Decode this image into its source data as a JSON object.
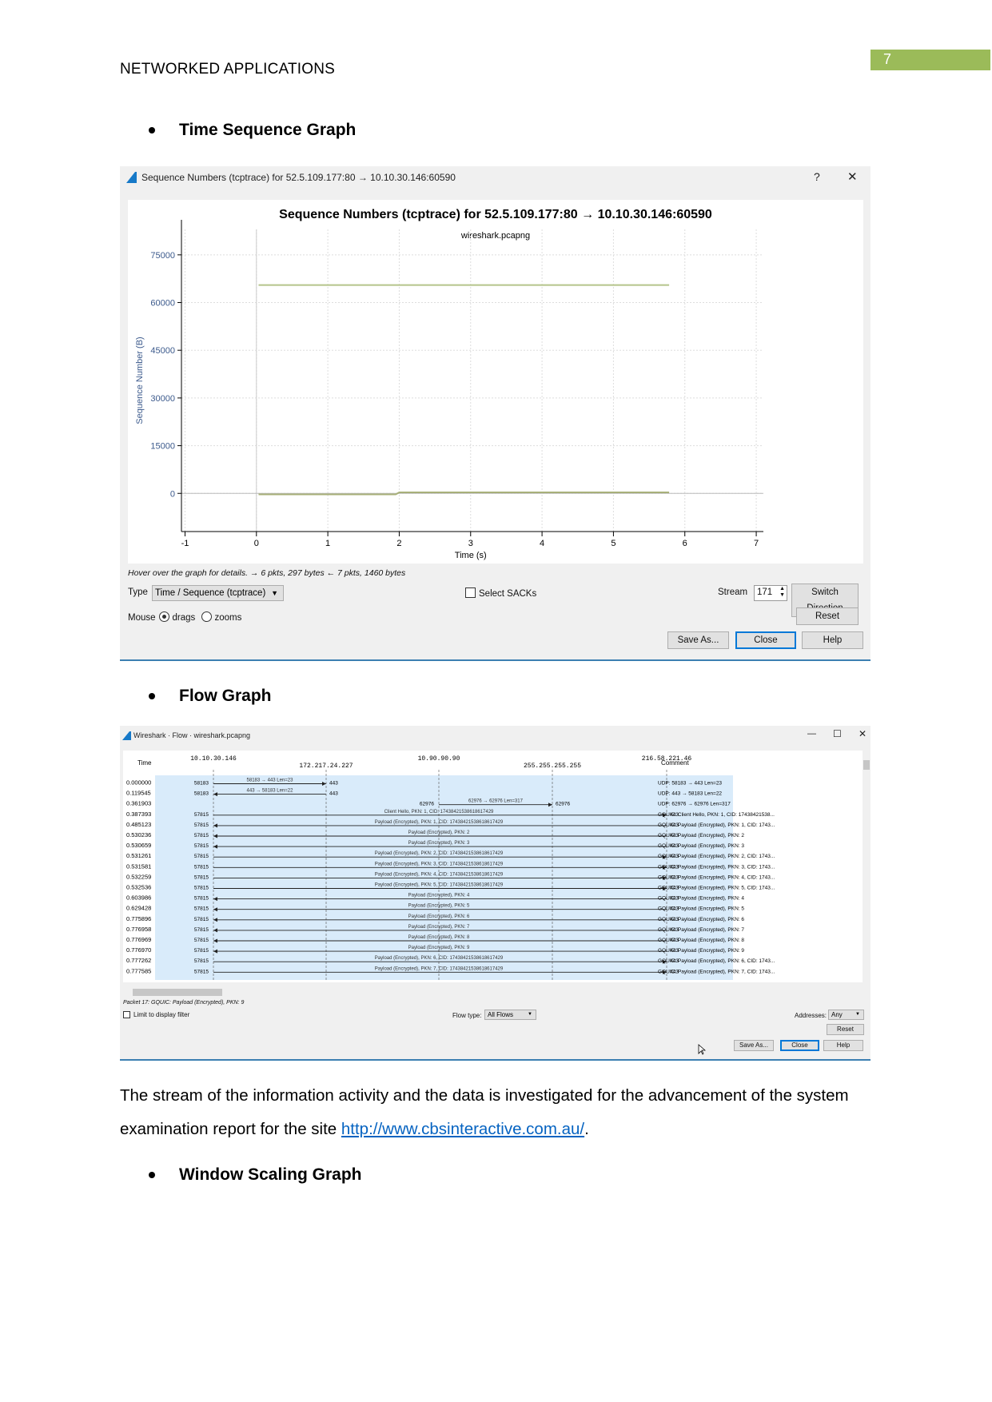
{
  "header": {
    "title": "NETWORKED APPLICATIONS",
    "page_number": "7",
    "accent": "#9bbb59"
  },
  "sections": [
    {
      "heading": "Time Sequence Graph"
    },
    {
      "heading": "Flow Graph"
    },
    {
      "heading": "Window Scaling Graph"
    }
  ],
  "paragraph": {
    "text_before": "The stream of the information activity and the data is investigated for the advancement of the system examination report for the site ",
    "link": "http://www.cbsinteractive.com.au/",
    "text_after": "."
  },
  "seq_window": {
    "title": "Sequence Numbers (tcptrace) for 52.5.109.177:80 → 10.10.30.146:60590",
    "help": "?",
    "close": "✕",
    "hover_text": "Hover over the graph for details. → 6 pkts, 297 bytes ← 7 pkts, 1460 bytes",
    "type_label": "Type",
    "type_value": "Time / Sequence (tcptrace)",
    "select_sacks": "Select SACKs",
    "stream_label": "Stream",
    "stream_value": "171",
    "switch_direction": "Switch Direction",
    "mouse_label": "Mouse",
    "drags": "drags",
    "zooms": "zooms",
    "mouse_mode": "drags",
    "reset": "Reset",
    "save_as": "Save As...",
    "close_btn": "Close",
    "help_btn": "Help"
  },
  "chart_data": {
    "type": "line",
    "title": "Sequence Numbers (tcptrace) for 52.5.109.177:80 → 10.10.30.146:60590",
    "subtitle": "wireshark.pcapng",
    "xlabel": "Time (s)",
    "ylabel": "Sequence Number (B)",
    "xlim": [
      -1.05,
      7.1
    ],
    "ylim": [
      -12000,
      83000
    ],
    "xticks": [
      "-1",
      "0",
      "1",
      "2",
      "3",
      "4",
      "5",
      "6",
      "7"
    ],
    "yticks": [
      "0",
      "15000",
      "30000",
      "45000",
      "60000",
      "75000"
    ],
    "grid": true,
    "series": [
      {
        "x": [
          0.03,
          5.78
        ],
        "y": [
          65500,
          65500
        ],
        "color": "#b5c48a"
      },
      {
        "x": [
          0.03,
          1.2,
          1.35,
          1.95,
          2.0,
          5.78
        ],
        "y": [
          -300,
          -300,
          -300,
          -300,
          300,
          300
        ],
        "color": "#a8b07a"
      }
    ],
    "zero_line_color": "#bbbbbb"
  },
  "flow_window": {
    "title": "Wireshark · Flow · wireshark.pcapng",
    "minimize": "—",
    "maximize": "☐",
    "close": "✕",
    "time_header": "Time",
    "comment_header": "Comment",
    "hosts": [
      "10.10.30.146",
      "172.217.24.227",
      "10.90.90.90",
      "255.255.255.255",
      "216.58.221.46"
    ],
    "rows": [
      {
        "time": "0.000000",
        "src": 0,
        "dst": 1,
        "sport": "58183",
        "dport": "443",
        "label": "58183 → 443 Len=23",
        "comment": "UDP: 58183 → 443 Len=23"
      },
      {
        "time": "0.119545",
        "src": 1,
        "dst": 0,
        "sport": "443",
        "dport": "58183",
        "label": "443 → 58183 Len=22",
        "comment": "UDP: 443 → 58183 Len=22"
      },
      {
        "time": "0.361903",
        "src": 2,
        "dst": 3,
        "sport": "62976",
        "dport": "62976",
        "label": "62976 → 62976 Len=317",
        "comment": "UDP: 62976 → 62976 Len=317"
      },
      {
        "time": "0.387393",
        "src": 0,
        "dst": 4,
        "sport": "57815",
        "dport": "443",
        "label": "Client Hello, PKN: 1, CID: 17438421538618617429",
        "comment": "GQUIC: Client Hello, PKN: 1, CID: 17438421538..."
      },
      {
        "time": "0.485123",
        "src": 4,
        "dst": 0,
        "sport": "443",
        "dport": "57815",
        "label": "Payload (Encrypted), PKN: 1, CID: 17438421538618617429",
        "comment": "GQUIC: Payload (Encrypted), PKN: 1, CID: 1743..."
      },
      {
        "time": "0.530236",
        "src": 4,
        "dst": 0,
        "sport": "443",
        "dport": "57815",
        "label": "Payload (Encrypted), PKN: 2",
        "comment": "GQUIC: Payload (Encrypted), PKN: 2"
      },
      {
        "time": "0.530659",
        "src": 4,
        "dst": 0,
        "sport": "443",
        "dport": "57815",
        "label": "Payload (Encrypted), PKN: 3",
        "comment": "GQUIC: Payload (Encrypted), PKN: 3"
      },
      {
        "time": "0.531261",
        "src": 0,
        "dst": 4,
        "sport": "57815",
        "dport": "443",
        "label": "Payload (Encrypted), PKN: 2, CID: 17438421538618617429",
        "comment": "GQUIC: Payload (Encrypted), PKN: 2, CID: 1743..."
      },
      {
        "time": "0.531581",
        "src": 0,
        "dst": 4,
        "sport": "57815",
        "dport": "443",
        "label": "Payload (Encrypted), PKN: 3, CID: 17438421538618617429",
        "comment": "GQUIC: Payload (Encrypted), PKN: 3, CID: 1743..."
      },
      {
        "time": "0.532259",
        "src": 0,
        "dst": 4,
        "sport": "57815",
        "dport": "443",
        "label": "Payload (Encrypted), PKN: 4, CID: 17438421538618617429",
        "comment": "GQUIC: Payload (Encrypted), PKN: 4, CID: 1743..."
      },
      {
        "time": "0.532536",
        "src": 0,
        "dst": 4,
        "sport": "57815",
        "dport": "443",
        "label": "Payload (Encrypted), PKN: 5, CID: 17438421538618617429",
        "comment": "GQUIC: Payload (Encrypted), PKN: 5, CID: 1743..."
      },
      {
        "time": "0.603986",
        "src": 4,
        "dst": 0,
        "sport": "443",
        "dport": "57815",
        "label": "Payload (Encrypted), PKN: 4",
        "comment": "GQUIC: Payload (Encrypted), PKN: 4"
      },
      {
        "time": "0.629428",
        "src": 4,
        "dst": 0,
        "sport": "443",
        "dport": "57815",
        "label": "Payload (Encrypted), PKN: 5",
        "comment": "GQUIC: Payload (Encrypted), PKN: 5"
      },
      {
        "time": "0.775896",
        "src": 4,
        "dst": 0,
        "sport": "443",
        "dport": "57815",
        "label": "Payload (Encrypted), PKN: 6",
        "comment": "GQUIC: Payload (Encrypted), PKN: 6"
      },
      {
        "time": "0.776958",
        "src": 4,
        "dst": 0,
        "sport": "443",
        "dport": "57815",
        "label": "Payload (Encrypted), PKN: 7",
        "comment": "GQUIC: Payload (Encrypted), PKN: 7"
      },
      {
        "time": "0.776969",
        "src": 4,
        "dst": 0,
        "sport": "443",
        "dport": "57815",
        "label": "Payload (Encrypted), PKN: 8",
        "comment": "GQUIC: Payload (Encrypted), PKN: 8"
      },
      {
        "time": "0.776970",
        "src": 4,
        "dst": 0,
        "sport": "443",
        "dport": "57815",
        "label": "Payload (Encrypted), PKN: 9",
        "comment": "GQUIC: Payload (Encrypted), PKN: 9"
      },
      {
        "time": "0.777262",
        "src": 0,
        "dst": 4,
        "sport": "57815",
        "dport": "443",
        "label": "Payload (Encrypted), PKN: 6, CID: 17438421538618617429",
        "comment": "GQUIC: Payload (Encrypted), PKN: 6, CID: 1743..."
      },
      {
        "time": "0.777585",
        "src": 0,
        "dst": 4,
        "sport": "57815",
        "dport": "443",
        "label": "Payload (Encrypted), PKN: 7, CID: 17438421538618617429",
        "comment": "GQUIC: Payload (Encrypted), PKN: 7, CID: 1743..."
      }
    ],
    "packet_text": "Packet 17: GQUIC: Payload (Encrypted), PKN: 9",
    "limit_filter": "Limit to display filter",
    "flow_type_label": "Flow type:",
    "flow_type_value": "All Flows",
    "addresses_label": "Addresses:",
    "addresses_value": "Any",
    "reset": "Reset",
    "save_as": "Save As...",
    "close_btn": "Close",
    "help_btn": "Help",
    "highlight_color": "#d9ebfa"
  }
}
